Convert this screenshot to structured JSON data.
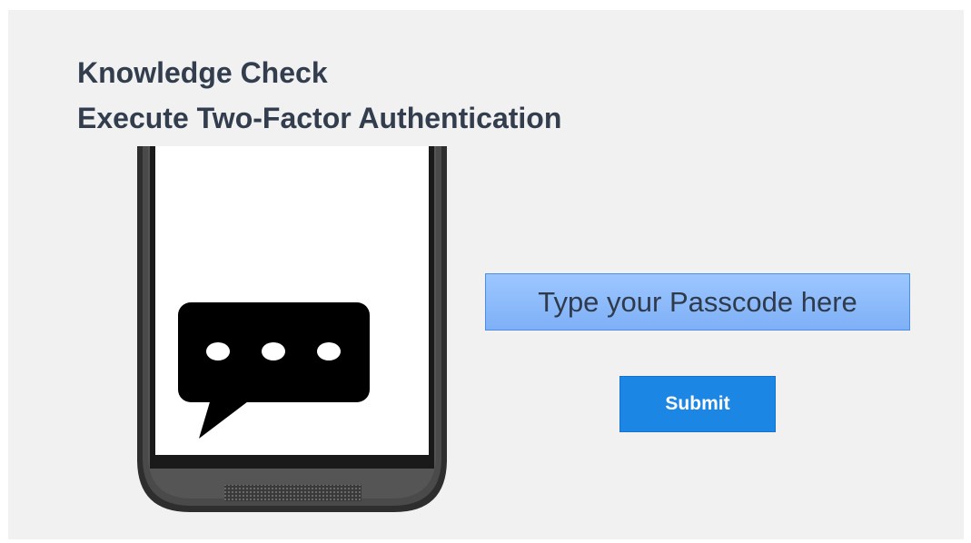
{
  "header": {
    "line1": "Knowledge Check",
    "line2": "Execute Two-Factor Authentication"
  },
  "phone": {
    "screen_icon": "chat-bubble-ellipsis-icon"
  },
  "passcode": {
    "label": "Type your Passcode here"
  },
  "actions": {
    "submit_label": "Submit"
  },
  "colors": {
    "background": "#f1f1f1",
    "title": "#323d4d",
    "field_fill": "#8fbcff",
    "submit_fill": "#1c86e5"
  }
}
